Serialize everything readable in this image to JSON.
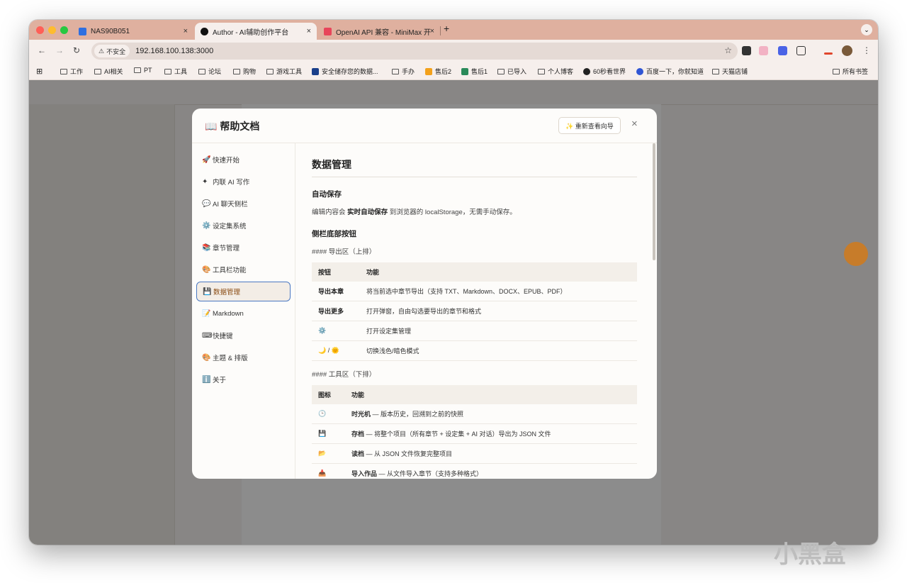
{
  "browser": {
    "tabs": [
      {
        "title": "NAS90B051",
        "close": "×"
      },
      {
        "title": "Author - AI辅助创作平台",
        "close": "×"
      },
      {
        "title": "OpenAI API 兼容 - MiniMax 开",
        "close": "×"
      }
    ],
    "new_tab": "+",
    "security_label": "不安全",
    "url": "192.168.100.138:3000",
    "bookmarks": [
      "工作",
      "AI相关",
      "PT",
      "工具",
      "论坛",
      "购物",
      "游戏工具",
      "安全储存您的数据...",
      "手办",
      "售后2",
      "售后1",
      "已导入",
      "个人博客",
      "60秒看世界",
      "百度一下，你就知道",
      "天猫店铺"
    ],
    "all_bookmarks": "所有书签"
  },
  "modal": {
    "title": "📖 帮助文档",
    "restart_button": "✨ 重新查看向导",
    "close": "×",
    "nav": [
      {
        "icon": "🚀",
        "label": "快速开始"
      },
      {
        "icon": "✦",
        "label": "内联 AI 写作"
      },
      {
        "icon": "💬",
        "label": "AI 聊天侧栏"
      },
      {
        "icon": "⚙️",
        "label": "设定集系统"
      },
      {
        "icon": "📚",
        "label": "章节管理"
      },
      {
        "icon": "🎨",
        "label": "工具栏功能"
      },
      {
        "icon": "💾",
        "label": "数据管理"
      },
      {
        "icon": "📝",
        "label": "Markdown"
      },
      {
        "icon": "⌨",
        "label": "快捷键"
      },
      {
        "icon": "🎨",
        "label": "主题 & 排版"
      },
      {
        "icon": "ℹ️",
        "label": "关于"
      }
    ],
    "selected_nav": "数据管理",
    "content": {
      "heading": "数据管理",
      "autosave_title": "自动保存",
      "autosave_pre": "编辑内容会 ",
      "autosave_bold": "实时自动保存",
      "autosave_post": " 到浏览器的 localStorage，无需手动保存。",
      "sidebar_buttons_title": "侧栏底部按钮",
      "export_area": "#### 导出区（上排）",
      "table1": {
        "headers": [
          "按钮",
          "功能"
        ],
        "rows": [
          [
            "导出本章",
            "将当前选中章节导出（支持 TXT、Markdown、DOCX、EPUB、PDF）"
          ],
          [
            "导出更多",
            "打开弹窗，自由勾选要导出的章节和格式"
          ],
          [
            "⚙️",
            "打开设定集管理"
          ],
          [
            "🌙 / 🌞",
            "切换浅色/暗色模式"
          ]
        ]
      },
      "tool_area": "#### 工具区（下排）",
      "table2": {
        "headers": [
          "图标",
          "功能"
        ],
        "rows": [
          [
            "🕒",
            "时光机",
            " — 版本历史，回溯到之前的快照"
          ],
          [
            "💾",
            "存档",
            " — 将整个项目（所有章节 + 设定集 + AI 对话）导出为 JSON 文件"
          ],
          [
            "📂",
            "读档",
            " — 从 JSON 文件恢复完整项目"
          ],
          [
            "📥",
            "导入作品",
            " — 从文件导入章节（支持多种格式）"
          ]
        ]
      }
    }
  },
  "watermark": "小黑盒",
  "colors": {
    "selected_border": "#4a78c2",
    "tabbar": "#dfb09f",
    "accent": "#c77c2a"
  }
}
